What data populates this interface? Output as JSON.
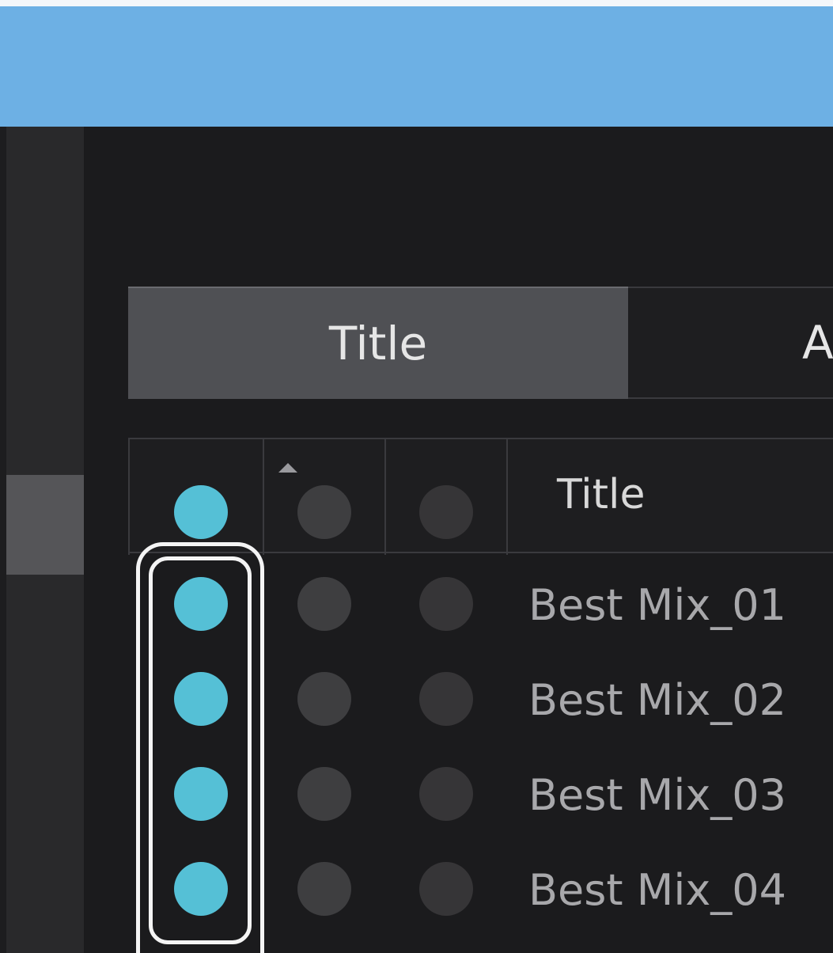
{
  "colors": {
    "title_bar": "#6db0e4",
    "accent_teal": "#55c0d6",
    "tab_active": "#4f5054",
    "background": "#1b1b1d"
  },
  "tabs": [
    {
      "label": "Title",
      "active": true
    },
    {
      "label": "A",
      "active": false
    }
  ],
  "table": {
    "header": {
      "column_title": "Title",
      "sort_icon": "sort-ascending-icon"
    },
    "rows": [
      {
        "title": "Best Mix_01"
      },
      {
        "title": "Best Mix_02"
      },
      {
        "title": "Best Mix_03"
      },
      {
        "title": "Best Mix_04"
      }
    ]
  }
}
